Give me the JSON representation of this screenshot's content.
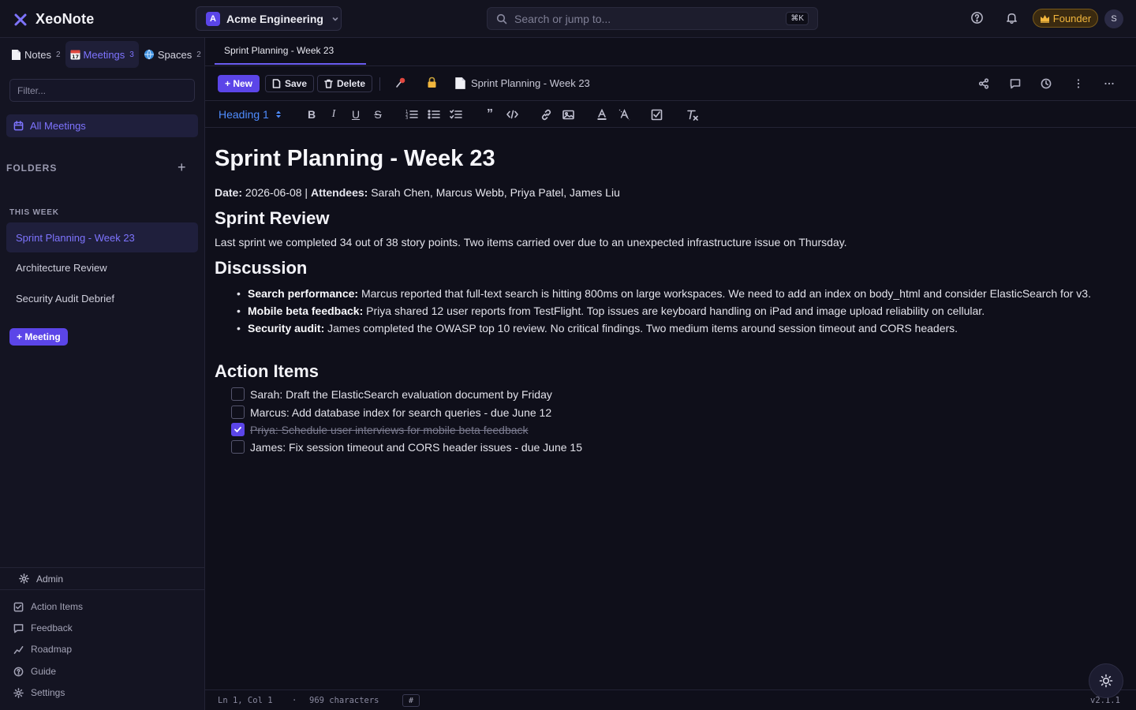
{
  "app": {
    "name": "XeoNote"
  },
  "workspace": {
    "badge": "A",
    "name": "Acme Engineering"
  },
  "search": {
    "placeholder": "Search or jump to...",
    "shortcut": "⌘K"
  },
  "topbar": {
    "founder_label": "Founder",
    "avatar_initial": "S"
  },
  "sidebar": {
    "tabs": [
      {
        "label": "Notes",
        "count": "2",
        "icon": "notes-icon"
      },
      {
        "label": "Meetings",
        "count": "3",
        "icon": "calendar-icon"
      },
      {
        "label": "Spaces",
        "count": "2",
        "icon": "globe-icon"
      }
    ],
    "filter_placeholder": "Filter...",
    "all_meetings": "All Meetings",
    "folders_label": "FOLDERS",
    "group_label": "THIS WEEK",
    "meetings": [
      "Sprint Planning - Week 23",
      "Architecture Review",
      "Security Audit Debrief"
    ],
    "add_meeting": "+ Meeting",
    "admin": "Admin",
    "footer": [
      "Action Items",
      "Feedback",
      "Roadmap",
      "Guide",
      "Settings"
    ]
  },
  "tab": {
    "title": "Sprint Planning - Week 23"
  },
  "toolbar": {
    "new": "+ New",
    "save": "Save",
    "delete": "Delete",
    "breadcrumb": "Sprint Planning - Week 23"
  },
  "format": {
    "block_type": "Heading 1"
  },
  "doc": {
    "title": "Sprint Planning - Week 23",
    "meta": {
      "date_label": "Date:",
      "date": "2026-06-08",
      "attendees_label": "Attendees:",
      "attendees": "Sarah Chen, Marcus Webb, Priya Patel, James Liu"
    },
    "review_heading": "Sprint Review",
    "review_text": "Last sprint we completed 34 out of 38 story points. Two items carried over due to an unexpected infrastructure issue on Thursday.",
    "discussion_heading": "Discussion",
    "discussion": [
      {
        "label": "Search performance:",
        "text": "Marcus reported that full-text search is hitting 800ms on large workspaces. We need to add an index on body_html and consider ElasticSearch for v3."
      },
      {
        "label": "Mobile beta feedback:",
        "text": "Priya shared 12 user reports from TestFlight. Top issues are keyboard handling on iPad and image upload reliability on cellular."
      },
      {
        "label": "Security audit:",
        "text": "James completed the OWASP top 10 review. No critical findings. Two medium items around session timeout and CORS headers."
      }
    ],
    "actions_heading": "Action Items",
    "actions": [
      {
        "text": "Sarah: Draft the ElasticSearch evaluation document by Friday",
        "done": false
      },
      {
        "text": "Marcus: Add database index for search queries - due June 12",
        "done": false
      },
      {
        "text": "Priya: Schedule user interviews for mobile beta feedback",
        "done": true
      },
      {
        "text": "James: Fix session timeout and CORS header issues - due June 15",
        "done": false
      }
    ]
  },
  "status": {
    "position": "Ln 1, Col 1",
    "dot": "·",
    "chars": "969 characters",
    "hash": "#",
    "version": "v2.1.1"
  },
  "colors": {
    "accent": "#5b45e8",
    "accent_text": "#7e74ff",
    "link_blue": "#4f8dff",
    "founder": "#f2b63d"
  }
}
